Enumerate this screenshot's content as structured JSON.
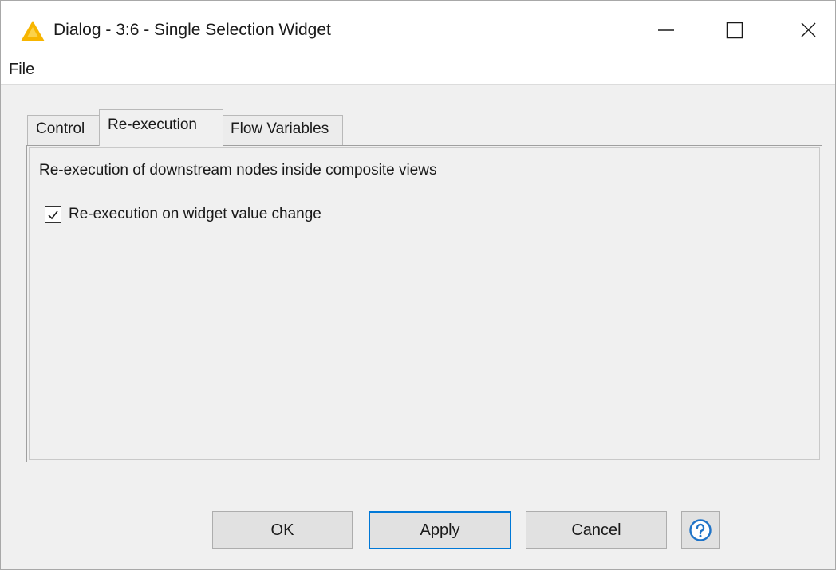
{
  "window": {
    "title": "Dialog - 3:6 - Single Selection Widget",
    "icon": "knime-triangle-icon",
    "controls": [
      "minimize-icon",
      "maximize-icon",
      "close-icon"
    ]
  },
  "menu": {
    "items": [
      {
        "label": "File"
      }
    ]
  },
  "tabs": [
    {
      "label": "Control",
      "active": false
    },
    {
      "label": "Re-execution",
      "active": true
    },
    {
      "label": "Flow Variables",
      "active": false
    }
  ],
  "panel": {
    "description": "Re-execution of downstream nodes inside composite views",
    "checkbox": {
      "label": "Re-execution on widget value change",
      "checked": true
    }
  },
  "buttons": {
    "ok": "OK",
    "apply": "Apply",
    "cancel": "Cancel",
    "help_icon": "help-icon"
  },
  "colors": {
    "accent": "#0078d7",
    "icon_yellow": "#f7b500"
  }
}
